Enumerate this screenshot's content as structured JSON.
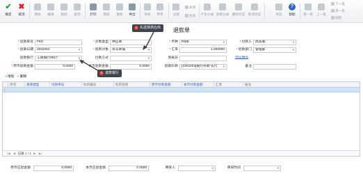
{
  "toolbar": {
    "left_buttons": [
      {
        "label": "确定",
        "icon": "check-icon",
        "enabled": true
      },
      {
        "label": "取消",
        "icon": "close-icon",
        "enabled": true
      },
      {
        "label": "增加",
        "icon": "add-icon",
        "enabled": false
      },
      {
        "label": "编辑",
        "icon": "edit-icon",
        "enabled": false
      },
      {
        "label": "删除",
        "icon": "delete-icon",
        "enabled": false
      },
      {
        "label": "查询",
        "icon": "search-icon",
        "enabled": false
      },
      {
        "label": "打印",
        "icon": "print-icon",
        "enabled": true
      },
      {
        "label": "预览",
        "icon": "preview-icon",
        "enabled": false
      },
      {
        "label": "模板",
        "icon": "template-icon",
        "enabled": false
      },
      {
        "label": "导出",
        "icon": "export-icon",
        "enabled": true
      },
      {
        "label": "审核",
        "icon": "approve-icon",
        "enabled": false
      },
      {
        "label": "弃审",
        "icon": "unapprove-icon",
        "enabled": false
      },
      {
        "label": "注销",
        "icon": "cancel-doc-icon",
        "enabled": false
      }
    ],
    "mini_buttons": [
      "关闭",
      "生效"
    ],
    "right_buttons": [
      {
        "label": "产生分录",
        "enabled": false
      },
      {
        "label": "查看分录",
        "enabled": false
      },
      {
        "label": "删除凭证",
        "enabled": false
      },
      {
        "label": "取消凭证",
        "enabled": false
      },
      {
        "label": "状态",
        "enabled": false
      },
      {
        "label": "帮助",
        "enabled": true
      }
    ],
    "nav_buttons": [
      "第一笔",
      "上一笔"
    ],
    "nav_mini": [
      "下一笔",
      "末一笔",
      "刷新"
    ]
  },
  "form": {
    "title": "退款单",
    "rows": [
      [
        {
          "label": "退款单号",
          "required": true,
          "value": "FKE",
          "type": "text"
        },
        {
          "label": "对象类型",
          "required": true,
          "value": "供应商",
          "type": "select"
        },
        {
          "label": "币种",
          "required": true,
          "value": "RMB",
          "type": "select"
        },
        {
          "label": "付款人",
          "required": true,
          "value": "周润发",
          "type": "select"
        }
      ],
      [
        {
          "label": "退款日期",
          "required": true,
          "value": "2022/9/2",
          "type": "select"
        },
        {
          "label": "退款对象",
          "required": true,
          "value": "京东商城",
          "type": "select"
        },
        {
          "label": "汇率",
          "required": true,
          "value": "1.000000",
          "type": "num"
        },
        {
          "label": "退款部门",
          "required": true,
          "value": "管理部",
          "type": "select"
        }
      ],
      [
        {
          "label": "退款银行",
          "required": false,
          "value": "工商银行8817",
          "type": "select"
        },
        {
          "label": "付款方式",
          "required": false,
          "value": "",
          "type": "select"
        },
        {
          "label": "到账日",
          "required": false,
          "value": "",
          "type": "text"
        },
        {
          "label": "",
          "required": false,
          "value": "源记编号",
          "type": "link"
        }
      ],
      [
        {
          "label": "原币退款金额",
          "required": true,
          "value": "0.0000",
          "type": "num"
        },
        {
          "label": "本币退款金额",
          "required": false,
          "value": "0.0000",
          "type": "num"
        },
        {
          "label": "退款科目",
          "required": false,
          "value": "[1002203]银行存款-农行",
          "type": "select"
        },
        {
          "label": "备注",
          "required": false,
          "value": "",
          "type": "text"
        }
      ]
    ]
  },
  "grid": {
    "toolbar": {
      "add_label": "增加",
      "delete_label": "删除"
    },
    "columns": [
      {
        "label": "序次",
        "style": "gray"
      },
      {
        "label": "来源类型",
        "style": "blue"
      },
      {
        "label": "付款单号",
        "style": "blue"
      },
      {
        "label": "科目编号",
        "style": "gray"
      },
      {
        "label": "科目名称",
        "style": "gray"
      },
      {
        "label": "原币付款金额",
        "style": "blue"
      },
      {
        "label": "本币付款金额",
        "style": "blue"
      },
      {
        "label": "汇率",
        "style": "gray"
      },
      {
        "label": "备注",
        "style": "gray"
      }
    ],
    "row_marker": "›",
    "pager": {
      "record_label": "记录 1 / 1"
    }
  },
  "footer": [
    {
      "label": "原币应退金额",
      "value": "0.0000"
    },
    {
      "label": "本币应退金额",
      "value": "0.0000"
    },
    {
      "label": "审核人",
      "value": ""
    },
    {
      "label": "审核时间",
      "value": ""
    }
  ],
  "tooltips": [
    {
      "number": "1",
      "text": "先选择供应商"
    },
    {
      "number": "2",
      "text": "退款银行"
    }
  ],
  "colors": {
    "accent": "#2f63c8",
    "required": "#d21111",
    "selected_row": "#cfe3f8",
    "tooltip_bg": "#3d434b",
    "tooltip_badge": "#e2462f"
  }
}
